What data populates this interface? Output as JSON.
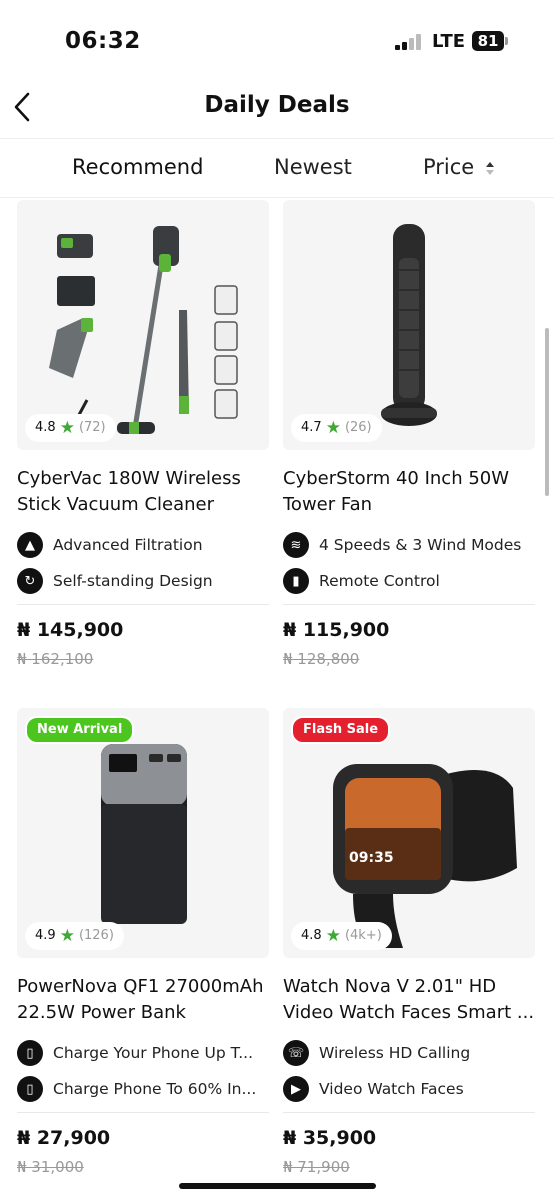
{
  "status": {
    "time": "06:32",
    "network": "LTE",
    "battery": "81"
  },
  "header": {
    "title": "Daily Deals"
  },
  "tabs": {
    "recommend": "Recommend",
    "newest": "Newest",
    "price": "Price"
  },
  "products": [
    {
      "name": "CyberVac 180W Wireless Stick Vacuum Cleaner",
      "rating": "4.8",
      "reviews": "(72)",
      "badge": "",
      "features": [
        {
          "icon": "filter-icon",
          "text": "Advanced Filtration"
        },
        {
          "icon": "stand-icon",
          "text": "Self-standing Design"
        }
      ],
      "price": "₦ 145,900",
      "old_price": "₦ 162,100"
    },
    {
      "name": "CyberStorm 40 Inch 50W Tower Fan",
      "rating": "4.7",
      "reviews": "(26)",
      "badge": "",
      "features": [
        {
          "icon": "wind-icon",
          "text": "4 Speeds & 3 Wind Modes"
        },
        {
          "icon": "remote-icon",
          "text": "Remote Control"
        }
      ],
      "price": "₦ 115,900",
      "old_price": "₦ 128,800"
    },
    {
      "name": "PowerNova QF1 27000mAh 22.5W Power Bank",
      "rating": "4.9",
      "reviews": "(126)",
      "badge": "New Arrival",
      "features": [
        {
          "icon": "phone-charge-icon",
          "text": "Charge Your Phone Up T..."
        },
        {
          "icon": "phone-icon",
          "text": "Charge Phone To 60% In..."
        }
      ],
      "price": "₦ 27,900",
      "old_price": "₦ 31,000"
    },
    {
      "name": "Watch Nova V 2.01\" HD Video Watch Faces Smart ...",
      "rating": "4.8",
      "reviews": "(4k+)",
      "badge": "Flash Sale",
      "features": [
        {
          "icon": "calling-icon",
          "text": "Wireless HD Calling"
        },
        {
          "icon": "play-icon",
          "text": "Video Watch Faces"
        }
      ],
      "price": "₦ 35,900",
      "old_price": "₦ 71,900"
    }
  ],
  "watch_time": "09:35",
  "colors": {
    "star": "#3ea934",
    "new_arrival": "#4cc51f",
    "flash_sale": "#e4202e"
  }
}
